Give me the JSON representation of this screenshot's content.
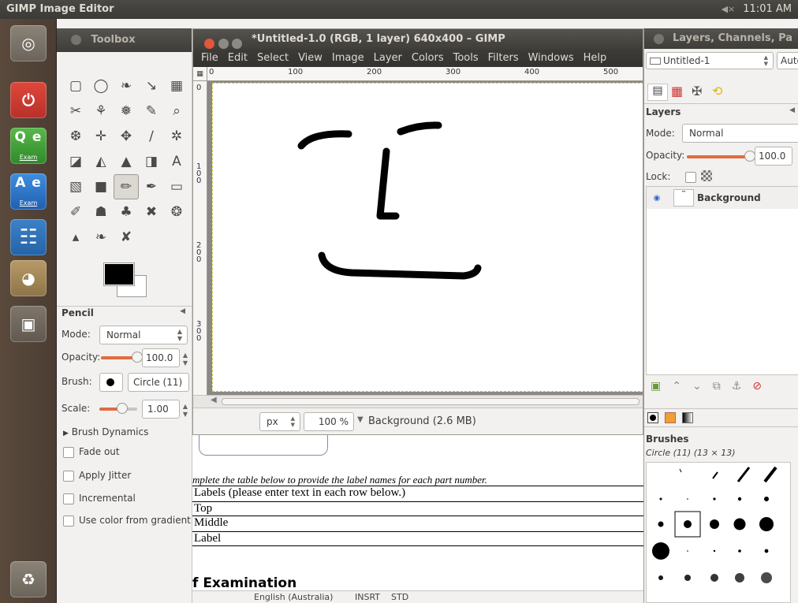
{
  "top_panel": {
    "title": "GIMP Image Editor",
    "volume": "◀×",
    "time": "11:01 AM"
  },
  "launcher": {
    "items": [
      {
        "name": "ubuntu-dash",
        "glyph": "◎"
      },
      {
        "name": "power",
        "glyph": "⏻"
      },
      {
        "name": "qe-exam",
        "top": "Q e",
        "sub": "Exam"
      },
      {
        "name": "ae-exam",
        "top": "A e",
        "sub": "Exam"
      },
      {
        "name": "writer",
        "glyph": "☷"
      },
      {
        "name": "gimp",
        "glyph": "◕"
      },
      {
        "name": "window",
        "glyph": "▣"
      },
      {
        "name": "trash",
        "glyph": "♻"
      }
    ]
  },
  "toolbox": {
    "title": "Toolbox",
    "tools": [
      "▢",
      "◯",
      "❧",
      "↘",
      "▦",
      "✂",
      "⚘",
      "❅",
      "✎",
      "⌕",
      "❆",
      "✛",
      "✥",
      "∕",
      "✲",
      "◪",
      "◭",
      "▲",
      "◨",
      "A",
      "▧",
      "■",
      "✏",
      "✒",
      "▭",
      "✐",
      "☗",
      "♣",
      "✖",
      "❂",
      "▴",
      "❧",
      "✘"
    ],
    "active_tool_index": 22,
    "options": {
      "heading": "Pencil",
      "mode_label": "Mode:",
      "mode_value": "Normal",
      "opacity_label": "Opacity:",
      "opacity_value": "100.0",
      "opacity_fraction": 1.0,
      "brush_label": "Brush:",
      "brush_value": "Circle (11)",
      "scale_label": "Scale:",
      "scale_value": "1.00",
      "dynamics": "Brush Dynamics",
      "checks": [
        "Fade out",
        "Apply Jitter",
        "Incremental",
        "Use color from gradient"
      ]
    }
  },
  "image_window": {
    "title": "*Untitled-1.0 (RGB, 1 layer) 640x400 – GIMP",
    "menu": [
      "File",
      "Edit",
      "Select",
      "View",
      "Image",
      "Layer",
      "Colors",
      "Tools",
      "Filters",
      "Windows",
      "Help"
    ],
    "ruler_h": [
      "0",
      "100",
      "200",
      "300",
      "400",
      "500"
    ],
    "ruler_v": [
      "0",
      "100",
      "200",
      "300"
    ],
    "unit": "px",
    "zoom": "100 %",
    "status": "Background (2.6 MB)"
  },
  "document": {
    "instruction": "mplete the table below to provide the label names for each part number.",
    "rows": [
      "Labels (please enter text in each row below.)",
      "Top",
      "Middle",
      "Label"
    ],
    "heading": "f Examination",
    "status_lang": "English (Australia)",
    "status_insrt": "INSRT",
    "status_std": "STD"
  },
  "layers_dock": {
    "title": "Layers, Channels, Pa",
    "image_select": "Untitled-1",
    "auto_label": "Auto",
    "layers_heading": "Layers",
    "mode_label": "Mode:",
    "mode_value": "Normal",
    "opacity_label": "Opacity:",
    "opacity_value": "100.0",
    "opacity_fraction": 1.0,
    "lock_label": "Lock:",
    "layer_name": "Background",
    "brushes_heading": "Brushes",
    "brush_current": "Circle (11) (13 × 13)"
  },
  "colors": {
    "accent": "#e06b3f",
    "panel_dark": "#3c3b37",
    "ubuntu_orange": "#dd4814"
  }
}
